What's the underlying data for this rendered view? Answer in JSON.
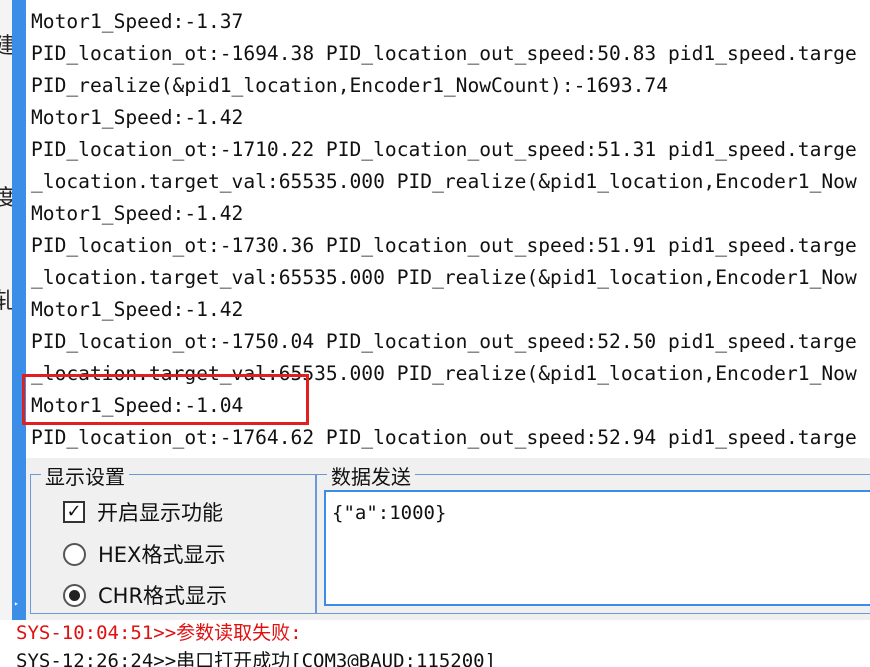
{
  "left_fragments": [
    "建",
    "度",
    "轧"
  ],
  "terminal": {
    "lines": [
      "Motor1_Speed:-1.37",
      "PID_location_ot:-1694.38 PID_location_out_speed:50.83 pid1_speed.targe",
      "PID_realize(&pid1_location,Encoder1_NowCount):-1693.74",
      "Motor1_Speed:-1.42",
      "PID_location_ot:-1710.22 PID_location_out_speed:51.31 pid1_speed.targe",
      "_location.target_val:65535.000 PID_realize(&pid1_location,Encoder1_Now",
      "Motor1_Speed:-1.42",
      "PID_location_ot:-1730.36 PID_location_out_speed:51.91 pid1_speed.targe",
      "_location.target_val:65535.000 PID_realize(&pid1_location,Encoder1_Now",
      "Motor1_Speed:-1.42",
      "PID_location_ot:-1750.04 PID_location_out_speed:52.50 pid1_speed.targe",
      "_location.target_val:65535.000 PID_realize(&pid1_location,Encoder1_Now",
      "Motor1_Speed:-1.04",
      "PID_location_ot:-1764.62 PID_location_out_speed:52.94 pid1_speed.targe"
    ]
  },
  "display_settings": {
    "title": "显示设置",
    "enable_display": "开启显示功能",
    "hex_display": "HEX格式显示",
    "chr_display": "CHR格式显示",
    "checkmark": "✓"
  },
  "data_send": {
    "title": "数据发送",
    "value": "{\"a\":1000}"
  },
  "log": {
    "line1": "SYS-10:04:51>>参数读取失败:",
    "line2": "SYS-12:26:24>>串口打开成功[COM3@BAUD:115200]"
  },
  "colors": {
    "accent": "#3a8ee8",
    "highlight_box": "#e02020",
    "error_text": "#e01010"
  }
}
